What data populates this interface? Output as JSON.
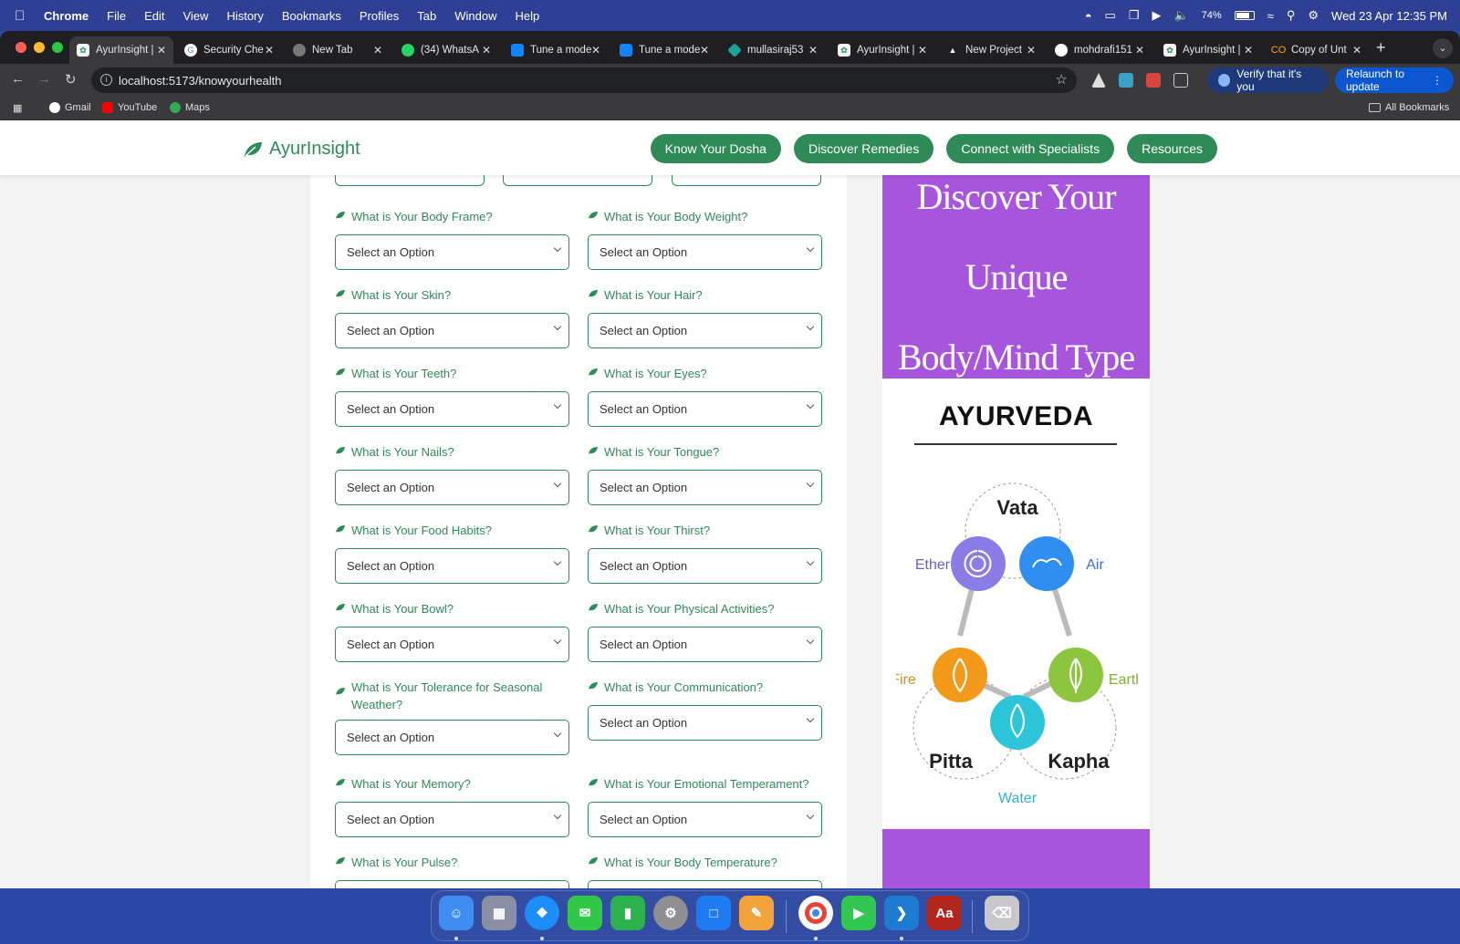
{
  "menubar": {
    "app": "Chrome",
    "items": [
      "File",
      "Edit",
      "View",
      "History",
      "Bookmarks",
      "Profiles",
      "Tab",
      "Window",
      "Help"
    ],
    "battery": "74%",
    "datetime": "Wed 23 Apr  12:35 PM"
  },
  "tabs": [
    {
      "title": "AyurInsight |",
      "icon": "ayurinsight-favicon",
      "active": true
    },
    {
      "title": "Security Che",
      "icon": "google-icon"
    },
    {
      "title": "New Tab",
      "icon": "chrome-icon"
    },
    {
      "title": "(34) WhatsA",
      "icon": "whatsapp-icon"
    },
    {
      "title": "Tune a mode",
      "icon": "bluesky-icon"
    },
    {
      "title": "Tune a mode",
      "icon": "bluesky-icon"
    },
    {
      "title": "mullasiraj53",
      "icon": "diamond-icon"
    },
    {
      "title": "AyurInsight |",
      "icon": "ayurinsight-favicon"
    },
    {
      "title": "New Project",
      "icon": "triangle-icon"
    },
    {
      "title": "mohdrafi151",
      "icon": "github-icon"
    },
    {
      "title": "AyurInsight |",
      "icon": "ayurinsight-favicon"
    },
    {
      "title": "Copy of Unt",
      "icon": "colab-icon"
    }
  ],
  "toolbar": {
    "url": "localhost:5173/knowyourhealth",
    "verify_label": "Verify that it's you",
    "relaunch_label": "Relaunch to update"
  },
  "bookmarks": {
    "items": [
      "Gmail",
      "YouTube",
      "Maps"
    ],
    "all_label": "All Bookmarks"
  },
  "site": {
    "brand": "AyurInsight",
    "nav": [
      "Know Your Dosha",
      "Discover Remedies",
      "Connect with Specialists",
      "Resources"
    ],
    "accent": "#2e8b57"
  },
  "form": {
    "placeholder": "Select an Option",
    "questions": [
      "What is Your Body Frame?",
      "What is Your Body Weight?",
      "What is Your Skin?",
      "What is Your Hair?",
      "What is Your Teeth?",
      "What is Your Eyes?",
      "What is Your Nails?",
      "What is Your Tongue?",
      "What is Your Food Habits?",
      "What is Your Thirst?",
      "What is Your Bowl?",
      "What is Your Physical Activities?",
      "What is Your Tolerance for Seasonal Weather?",
      "What is Your Communication?",
      "What is Your Memory?",
      "What is Your Emotional Temperament?",
      "What is Your Pulse?",
      "What is Your Body Temperature?"
    ]
  },
  "poster": {
    "line1": "Discover Your Unique",
    "line2": "Body/Mind Type",
    "title": "AYURVEDA",
    "doshas": [
      "Vata",
      "Pitta",
      "Kapha"
    ],
    "elements": [
      "Ether",
      "Air",
      "Fire",
      "Earth",
      "Water"
    ],
    "bg_color": "#a855dd"
  },
  "dock": [
    "Finder",
    "Launchpad",
    "Safari",
    "Messages",
    "Numbers",
    "System Settings",
    "Keynote",
    "Pages",
    "Chrome",
    "FaceTime",
    "VS Code",
    "Dictionary",
    "Trash"
  ]
}
